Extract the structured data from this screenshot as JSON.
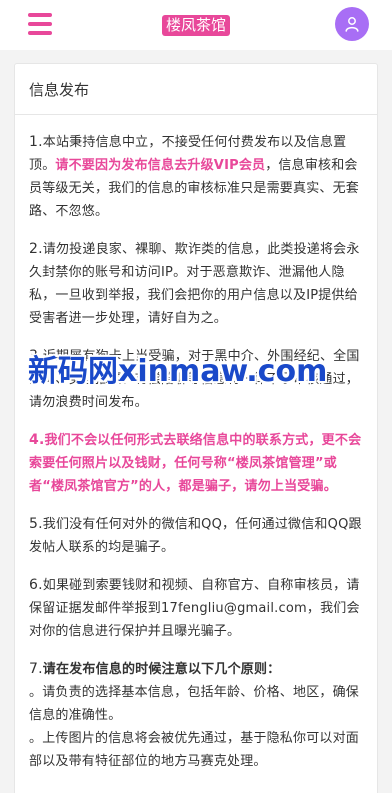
{
  "header": {
    "logo": "楼凤茶馆",
    "menu_icon": "hamburger-menu-icon",
    "avatar_icon": "user-icon"
  },
  "card": {
    "title": "信息发布",
    "p1": {
      "num": "1.",
      "text_a": "本站秉持信息中立，不接受任何付费发布以及信息置顶。",
      "highlight": "请不要因为发布信息去升级VIP会员",
      "text_b": "，信息审核和会员等级无关，我们的信息的审核标准只是需要真实、无套路、不忽悠。"
    },
    "p2": {
      "num": "2.",
      "text": "请勿投递良家、裸聊、欺诈类的信息，此类投递将会永久封禁你的账号和访问IP。对于恶意欺诈、泄漏他人隐私，一旦收到举报，我们会把你的用户信息以及IP提供给受害者进一步处理，请好自为之。"
    },
    "p3": {
      "num": "3.",
      "text": "近期屡有狗卡上当受骗，对于黑中介、外围经纪、全国空降、卖淫招嫖、有偿陪聊等信息将一律不予审核通过，请勿浪费时间发布。"
    },
    "p4": {
      "num": "4.",
      "text": "我们不会以任何形式去联络信息中的联系方式，更不会索要任何照片以及钱财，任何号称“楼凤茶馆管理”或者“楼凤茶馆官方”的人，都是骗子，请勿上当受骗。"
    },
    "p5": {
      "num": "5.",
      "text": "我们没有任何对外的微信和QQ，任何通过微信和QQ跟发帖人联系的均是骗子。"
    },
    "p6": {
      "num": "6.",
      "text": "如果碰到索要钱财和视频、自称官方、自称审核员，请保留证据发邮件举报到17fengliu@gmail.com，我们会对你的信息进行保护并且曝光骗子。"
    },
    "p7": {
      "num": "7.",
      "title": "请在发布信息的时候注意以下几个原则：",
      "item1": "。请负责的选择基本信息，包括年龄、价格、地区，确保信息的准确性。",
      "item2": "。上传图片的信息将会被优先通过，基于隐私你可以对面部以及带有特征部位的地方马赛克处理。"
    }
  },
  "watermark": "新码网xinmaw.com",
  "colors": {
    "accent": "#e8489a",
    "avatar": "#a86ef5",
    "watermark": "#1a49c9"
  }
}
